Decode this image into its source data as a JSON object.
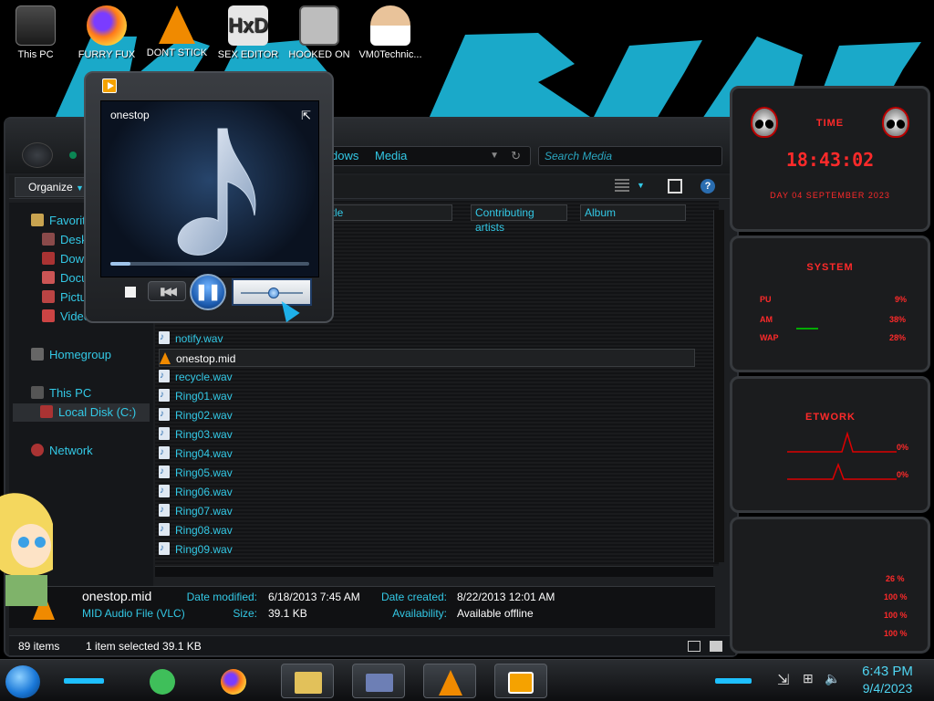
{
  "desktop_icons": [
    {
      "label": "This PC",
      "icon": "computer-icon",
      "color": "#3a3a3a"
    },
    {
      "label": "FURRY FUX",
      "icon": "firefox-icon",
      "color": "#ff7a18"
    },
    {
      "label": "DONT STICK",
      "icon": "vlc-icon",
      "color": "#f08a00"
    },
    {
      "label": "SEX EDITOR",
      "icon": "hex-editor-icon",
      "color": "#e6e6e6"
    },
    {
      "label": "HOOKED ON",
      "icon": "app-icon",
      "color": "#bdbdbd"
    },
    {
      "label": "VM0Technic...",
      "icon": "doctor-avatar-icon",
      "color": "#e9c39a"
    }
  ],
  "explorer": {
    "breadcrumb": [
      "dows",
      "Media"
    ],
    "search_placeholder": "Search Media",
    "organize_label": "Organize",
    "columns": [
      "itle",
      "Contributing artists",
      "Album"
    ],
    "sidebar": {
      "favorites": "Favorite",
      "favorite_items": [
        "Deskt",
        "Down",
        "Docu",
        "Pictu",
        "Video"
      ],
      "homegroup": "Homegroup",
      "this_pc": "This PC",
      "local_disk": "Local Disk (C:)",
      "network": "Network"
    },
    "files": [
      {
        "name": "notify.wav",
        "selected": false
      },
      {
        "name": "onestop.mid",
        "selected": true
      },
      {
        "name": "recycle.wav",
        "selected": false
      },
      {
        "name": "Ring01.wav",
        "selected": false
      },
      {
        "name": "Ring02.wav",
        "selected": false
      },
      {
        "name": "Ring03.wav",
        "selected": false
      },
      {
        "name": "Ring04.wav",
        "selected": false
      },
      {
        "name": "Ring05.wav",
        "selected": false
      },
      {
        "name": "Ring06.wav",
        "selected": false
      },
      {
        "name": "Ring07.wav",
        "selected": false
      },
      {
        "name": "Ring08.wav",
        "selected": false
      },
      {
        "name": "Ring09.wav",
        "selected": false
      }
    ],
    "details": {
      "filename": "onestop.mid",
      "filetype": "MID Audio File (VLC)",
      "date_modified_label": "Date modified:",
      "date_modified": "6/18/2013 7:45 AM",
      "size_label": "Size:",
      "size": "39.1 KB",
      "date_created_label": "Date created:",
      "date_created": "8/22/2013 12:01 AM",
      "availability_label": "Availability:",
      "availability": "Available offline"
    },
    "status": {
      "items": "89 items",
      "selected": "1 item selected  39.1 KB"
    }
  },
  "player": {
    "title": "onestop",
    "seek_progress": 0.1,
    "volume": 0.6
  },
  "gadgets": {
    "time_title": "TIME",
    "time": "18:43:02",
    "date_line": "DAY 04 SEPTEMBER 2023",
    "system_title": "SYSTEM",
    "cpu_label": "PU",
    "cpu_value": "9%",
    "ram_label": "AM",
    "ram_value": "38%",
    "swap_label": "WAP",
    "swap_value": "28%",
    "network_title": "ETWORK",
    "net_up": "0%",
    "net_down": "0%",
    "disk_values": [
      "26 %",
      "100 %",
      "100 %",
      "100 %"
    ]
  },
  "taskbar": {
    "time": "6:43 PM",
    "date": "9/4/2023",
    "accent": "#1ec0ff"
  }
}
